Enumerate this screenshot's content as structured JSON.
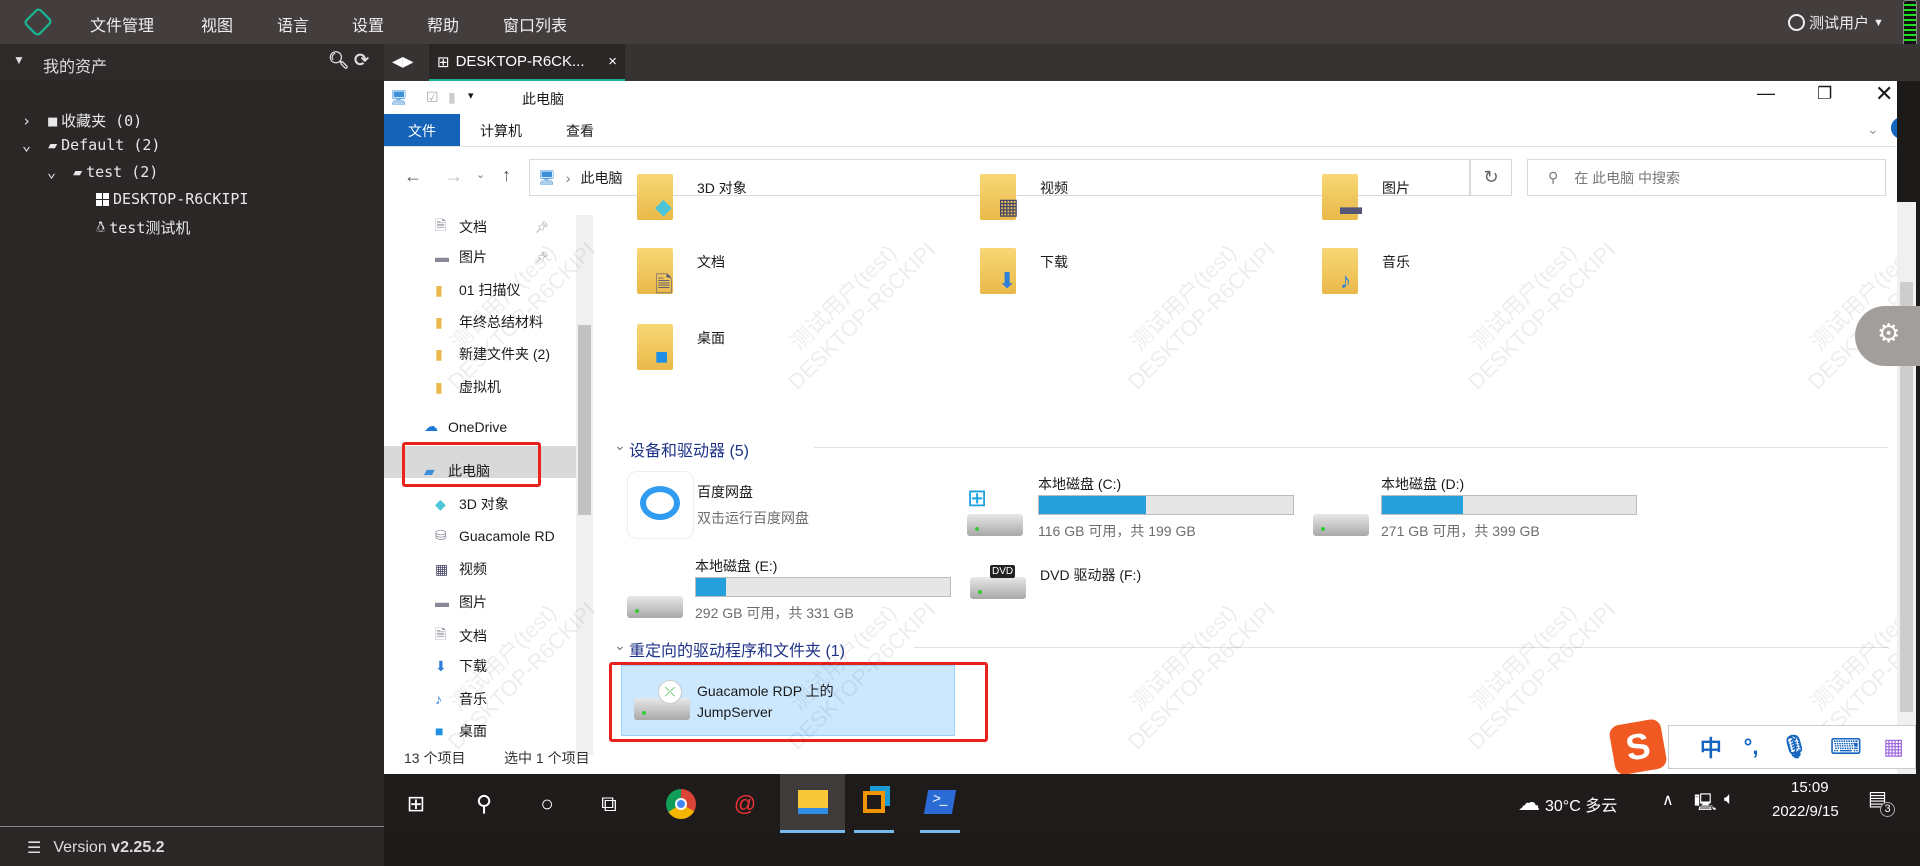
{
  "app": {
    "menu": [
      "文件管理",
      "视图",
      "语言",
      "设置",
      "帮助",
      "窗口列表"
    ],
    "user": "测试用户",
    "accent": "#1ab394"
  },
  "assets": {
    "title": "我的资产",
    "tree": [
      {
        "label": "收藏夹 (0)"
      },
      {
        "label": "Default (2)"
      },
      {
        "label": "test (2)"
      },
      {
        "label": "DESKTOP-R6CKIPI",
        "icon": "windows-icon"
      },
      {
        "label": "test测试机",
        "icon": "linux-icon"
      }
    ],
    "version_label": "Version",
    "version": "v2.25.2"
  },
  "tab": {
    "title": "DESKTOP-R6CK...",
    "close": "×"
  },
  "explorer": {
    "title": "此电脑",
    "ribbon_tabs": [
      "文件",
      "计算机",
      "查看"
    ],
    "address": "此电脑",
    "search_placeholder": "在 此电脑 中搜索",
    "nav": [
      "文档",
      "图片",
      "01 扫描仪",
      "年终总结材料",
      "新建文件夹 (2)",
      "虚拟机",
      "OneDrive",
      "此电脑",
      "3D 对象",
      "Guacamole RD",
      "视频",
      "图片",
      "文档",
      "下载",
      "音乐",
      "桌面"
    ],
    "folders": [
      "3D 对象",
      "视频",
      "图片",
      "文档",
      "下载",
      "音乐",
      "桌面"
    ],
    "devices_header": "设备和驱动器 (5)",
    "baidu": {
      "name": "百度网盘",
      "sub": "双击运行百度网盘"
    },
    "drives": [
      {
        "name": "本地磁盘 (C:)",
        "info": "116 GB 可用，共 199 GB",
        "used_pct": 42
      },
      {
        "name": "本地磁盘 (D:)",
        "info": "271 GB 可用，共 399 GB",
        "used_pct": 32
      },
      {
        "name": "本地磁盘 (E:)",
        "info": "292 GB 可用，共 331 GB",
        "used_pct": 12
      }
    ],
    "dvd": {
      "name": "DVD 驱动器 (F:)",
      "badge": "DVD"
    },
    "redirect_header": "重定向的驱动程序和文件夹 (1)",
    "redirect_item": [
      "Guacamole RDP 上的",
      "JumpServer"
    ],
    "status": {
      "count": "13 个项目",
      "selected": "选中 1 个项目"
    }
  },
  "watermark": {
    "user": "测试用户(test)",
    "host": "DESKTOP-R6CKIPI"
  },
  "ime": {
    "mode": "中",
    "punct": "°,"
  },
  "taskbar": {
    "weather": "30°C  多云",
    "time": "15:09",
    "date": "2022/9/15",
    "notifications": "3"
  }
}
